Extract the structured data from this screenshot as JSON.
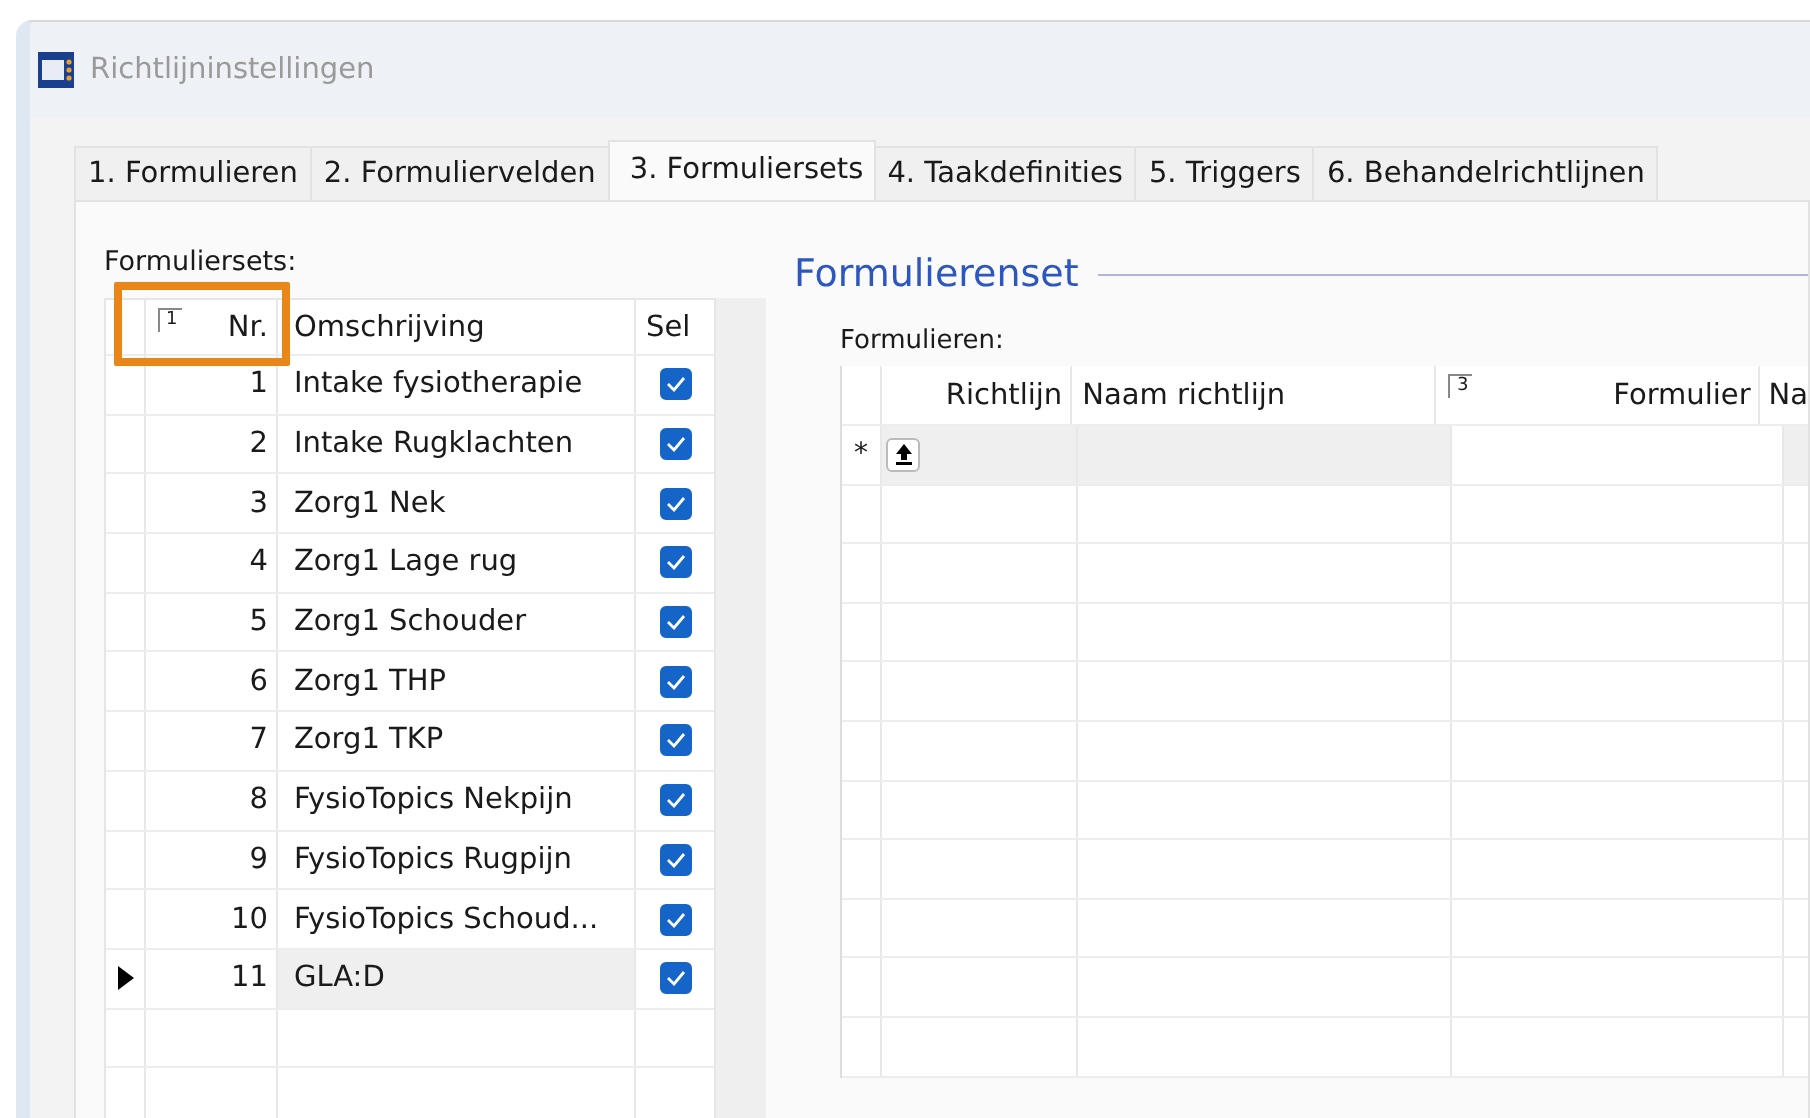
{
  "window": {
    "title": "Richtlijninstellingen"
  },
  "tabs": [
    {
      "label": "1. Formulieren",
      "selected": false
    },
    {
      "label": "2. Formuliervelden",
      "selected": false
    },
    {
      "label": "3. Formuliersets",
      "selected": true
    },
    {
      "label": "4. Taakdefinities",
      "selected": false
    },
    {
      "label": "5. Triggers",
      "selected": false
    },
    {
      "label": "6. Behandelrichtlijnen",
      "selected": false
    }
  ],
  "sets": {
    "label": "Formuliersets:",
    "columns": [
      {
        "title": "Nr.",
        "sort_order": "1"
      },
      {
        "title": "Omschrijving"
      },
      {
        "title": "Sel"
      }
    ],
    "rows": [
      {
        "nr": "1",
        "description": "Intake fysiotherapie",
        "checked": true,
        "selected": false
      },
      {
        "nr": "2",
        "description": "Intake Rugklachten",
        "checked": true,
        "selected": false
      },
      {
        "nr": "3",
        "description": "Zorg1 Nek",
        "checked": true,
        "selected": false
      },
      {
        "nr": "4",
        "description": "Zorg1 Lage rug",
        "checked": true,
        "selected": false
      },
      {
        "nr": "5",
        "description": "Zorg1 Schouder",
        "checked": true,
        "selected": false
      },
      {
        "nr": "6",
        "description": "Zorg1 THP",
        "checked": true,
        "selected": false
      },
      {
        "nr": "7",
        "description": "Zorg1 TKP",
        "checked": true,
        "selected": false
      },
      {
        "nr": "8",
        "description": "FysioTopics Nekpijn",
        "checked": true,
        "selected": false
      },
      {
        "nr": "9",
        "description": "FysioTopics Rugpijn",
        "checked": true,
        "selected": false
      },
      {
        "nr": "10",
        "description": "FysioTopics Schoud...",
        "checked": true,
        "selected": false
      },
      {
        "nr": "11",
        "description": "GLA:D",
        "checked": true,
        "selected": true
      }
    ]
  },
  "detail": {
    "heading": "Formulierenset",
    "label": "Formulieren:",
    "columns": [
      {
        "title": "Richtlijn"
      },
      {
        "title": "Naam richtlijn"
      },
      {
        "title": "Formulier",
        "sort_order": "3"
      },
      {
        "title": "Na"
      }
    ],
    "new_row_marker": "*"
  }
}
